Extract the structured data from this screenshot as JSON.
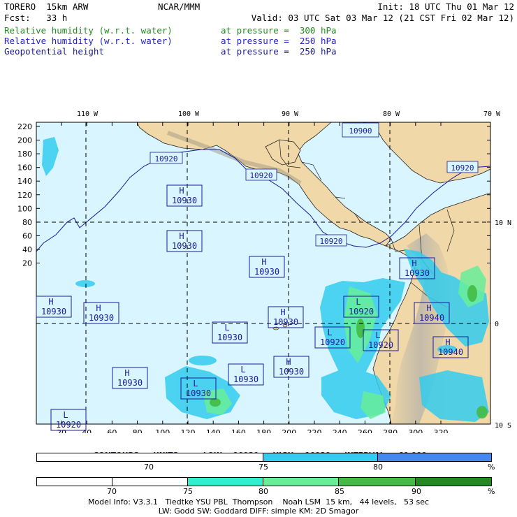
{
  "header": {
    "left_line1": "TORERO  15km ARW",
    "center_line1": "NCAR/MMM",
    "right_line1": "Init: 18 UTC Thu 01 Mar 12",
    "left_line2": "Fcst:   33 h",
    "right_line2": "Valid: 03 UTC Sat 03 Mar 12 (21 CST Fri 02 Mar 12)"
  },
  "fields": [
    {
      "name": "Relative humidity (w.r.t. water)",
      "pressure": "at pressure =  300 hPa",
      "color": "#1f8f1f"
    },
    {
      "name": "Relative humidity (w.r.t. water)",
      "pressure": "at pressure =  250 hPa",
      "color": "#2222cc"
    },
    {
      "name": "Geopotential height",
      "pressure": "at pressure =  250 hPa",
      "color": "#1a1a9c"
    }
  ],
  "map": {
    "lon_labels": [
      "110 W",
      "100 W",
      "90 W",
      "80 W",
      "70 W"
    ],
    "lat_labels": [
      "10 N",
      "0",
      "10 S"
    ],
    "y_ticks": [
      "220",
      "200",
      "180",
      "160",
      "140",
      "120",
      "100",
      "80",
      "60",
      "40",
      "20"
    ],
    "x_ticks": [
      "20",
      "40",
      "60",
      "80",
      "100",
      "120",
      "140",
      "160",
      "180",
      "200",
      "220",
      "240",
      "260",
      "280",
      "300",
      "320"
    ],
    "contour_labels": [
      "10900",
      "10920",
      "10920",
      "10920",
      "10920"
    ],
    "pressure_centers": [
      {
        "kind": "H",
        "value": "10930"
      },
      {
        "kind": "H",
        "value": "10930"
      },
      {
        "kind": "H",
        "value": "10930"
      },
      {
        "kind": "H",
        "value": "10930"
      },
      {
        "kind": "H",
        "value": "10930"
      },
      {
        "kind": "H",
        "value": "10930"
      },
      {
        "kind": "H",
        "value": "10930"
      },
      {
        "kind": "H",
        "value": "10930"
      },
      {
        "kind": "H",
        "value": "10930"
      },
      {
        "kind": "H",
        "value": "10940"
      },
      {
        "kind": "H",
        "value": "10940"
      },
      {
        "kind": "L",
        "value": "10930"
      },
      {
        "kind": "L",
        "value": "10930"
      },
      {
        "kind": "L",
        "value": "10930"
      },
      {
        "kind": "L",
        "value": "10920"
      },
      {
        "kind": "L",
        "value": "10920"
      },
      {
        "kind": "L",
        "value": "10920"
      },
      {
        "kind": "L",
        "value": "10920"
      }
    ],
    "colors": {
      "ocean": "#d9f5ff",
      "land": "#f0d8a8",
      "contour": "#1a1a9c"
    }
  },
  "contour_info": {
    "prefix": "CONTOURS:",
    "units": "UNITS=m",
    "low": "LOW=  10920.",
    "high": "HIGH=  10930.",
    "interval": "INTERVAL=   60.000"
  },
  "legend_250": {
    "ticks": [
      "70",
      "75",
      "80"
    ],
    "unit": "%",
    "colors": [
      "#ffffff",
      "#33ccee",
      "#4488ee"
    ]
  },
  "legend_300": {
    "ticks": [
      "70",
      "75",
      "80",
      "85",
      "90"
    ],
    "unit": "%",
    "colors": [
      "#ffffff",
      "#ffffff",
      "#33eecc",
      "#66ee99",
      "#44bb44",
      "#228822"
    ]
  },
  "footer": {
    "line1": "Model Info: V3.3.1   Tiedtke YSU PBL  Thompson    Noah LSM  15 km,   44 levels,   53 sec",
    "line2": "LW: Godd SW: Goddard DIFF: simple KM: 2D Smagor"
  }
}
